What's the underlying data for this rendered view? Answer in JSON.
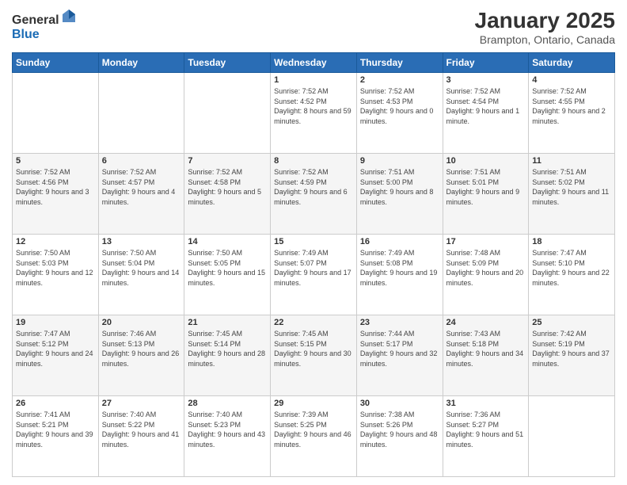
{
  "header": {
    "logo_general": "General",
    "logo_blue": "Blue",
    "month_year": "January 2025",
    "location": "Brampton, Ontario, Canada"
  },
  "days_of_week": [
    "Sunday",
    "Monday",
    "Tuesday",
    "Wednesday",
    "Thursday",
    "Friday",
    "Saturday"
  ],
  "weeks": [
    [
      {
        "day": "",
        "sunrise": "",
        "sunset": "",
        "daylight": ""
      },
      {
        "day": "",
        "sunrise": "",
        "sunset": "",
        "daylight": ""
      },
      {
        "day": "",
        "sunrise": "",
        "sunset": "",
        "daylight": ""
      },
      {
        "day": "1",
        "sunrise": "Sunrise: 7:52 AM",
        "sunset": "Sunset: 4:52 PM",
        "daylight": "Daylight: 8 hours and 59 minutes."
      },
      {
        "day": "2",
        "sunrise": "Sunrise: 7:52 AM",
        "sunset": "Sunset: 4:53 PM",
        "daylight": "Daylight: 9 hours and 0 minutes."
      },
      {
        "day": "3",
        "sunrise": "Sunrise: 7:52 AM",
        "sunset": "Sunset: 4:54 PM",
        "daylight": "Daylight: 9 hours and 1 minute."
      },
      {
        "day": "4",
        "sunrise": "Sunrise: 7:52 AM",
        "sunset": "Sunset: 4:55 PM",
        "daylight": "Daylight: 9 hours and 2 minutes."
      }
    ],
    [
      {
        "day": "5",
        "sunrise": "Sunrise: 7:52 AM",
        "sunset": "Sunset: 4:56 PM",
        "daylight": "Daylight: 9 hours and 3 minutes."
      },
      {
        "day": "6",
        "sunrise": "Sunrise: 7:52 AM",
        "sunset": "Sunset: 4:57 PM",
        "daylight": "Daylight: 9 hours and 4 minutes."
      },
      {
        "day": "7",
        "sunrise": "Sunrise: 7:52 AM",
        "sunset": "Sunset: 4:58 PM",
        "daylight": "Daylight: 9 hours and 5 minutes."
      },
      {
        "day": "8",
        "sunrise": "Sunrise: 7:52 AM",
        "sunset": "Sunset: 4:59 PM",
        "daylight": "Daylight: 9 hours and 6 minutes."
      },
      {
        "day": "9",
        "sunrise": "Sunrise: 7:51 AM",
        "sunset": "Sunset: 5:00 PM",
        "daylight": "Daylight: 9 hours and 8 minutes."
      },
      {
        "day": "10",
        "sunrise": "Sunrise: 7:51 AM",
        "sunset": "Sunset: 5:01 PM",
        "daylight": "Daylight: 9 hours and 9 minutes."
      },
      {
        "day": "11",
        "sunrise": "Sunrise: 7:51 AM",
        "sunset": "Sunset: 5:02 PM",
        "daylight": "Daylight: 9 hours and 11 minutes."
      }
    ],
    [
      {
        "day": "12",
        "sunrise": "Sunrise: 7:50 AM",
        "sunset": "Sunset: 5:03 PM",
        "daylight": "Daylight: 9 hours and 12 minutes."
      },
      {
        "day": "13",
        "sunrise": "Sunrise: 7:50 AM",
        "sunset": "Sunset: 5:04 PM",
        "daylight": "Daylight: 9 hours and 14 minutes."
      },
      {
        "day": "14",
        "sunrise": "Sunrise: 7:50 AM",
        "sunset": "Sunset: 5:05 PM",
        "daylight": "Daylight: 9 hours and 15 minutes."
      },
      {
        "day": "15",
        "sunrise": "Sunrise: 7:49 AM",
        "sunset": "Sunset: 5:07 PM",
        "daylight": "Daylight: 9 hours and 17 minutes."
      },
      {
        "day": "16",
        "sunrise": "Sunrise: 7:49 AM",
        "sunset": "Sunset: 5:08 PM",
        "daylight": "Daylight: 9 hours and 19 minutes."
      },
      {
        "day": "17",
        "sunrise": "Sunrise: 7:48 AM",
        "sunset": "Sunset: 5:09 PM",
        "daylight": "Daylight: 9 hours and 20 minutes."
      },
      {
        "day": "18",
        "sunrise": "Sunrise: 7:47 AM",
        "sunset": "Sunset: 5:10 PM",
        "daylight": "Daylight: 9 hours and 22 minutes."
      }
    ],
    [
      {
        "day": "19",
        "sunrise": "Sunrise: 7:47 AM",
        "sunset": "Sunset: 5:12 PM",
        "daylight": "Daylight: 9 hours and 24 minutes."
      },
      {
        "day": "20",
        "sunrise": "Sunrise: 7:46 AM",
        "sunset": "Sunset: 5:13 PM",
        "daylight": "Daylight: 9 hours and 26 minutes."
      },
      {
        "day": "21",
        "sunrise": "Sunrise: 7:45 AM",
        "sunset": "Sunset: 5:14 PM",
        "daylight": "Daylight: 9 hours and 28 minutes."
      },
      {
        "day": "22",
        "sunrise": "Sunrise: 7:45 AM",
        "sunset": "Sunset: 5:15 PM",
        "daylight": "Daylight: 9 hours and 30 minutes."
      },
      {
        "day": "23",
        "sunrise": "Sunrise: 7:44 AM",
        "sunset": "Sunset: 5:17 PM",
        "daylight": "Daylight: 9 hours and 32 minutes."
      },
      {
        "day": "24",
        "sunrise": "Sunrise: 7:43 AM",
        "sunset": "Sunset: 5:18 PM",
        "daylight": "Daylight: 9 hours and 34 minutes."
      },
      {
        "day": "25",
        "sunrise": "Sunrise: 7:42 AM",
        "sunset": "Sunset: 5:19 PM",
        "daylight": "Daylight: 9 hours and 37 minutes."
      }
    ],
    [
      {
        "day": "26",
        "sunrise": "Sunrise: 7:41 AM",
        "sunset": "Sunset: 5:21 PM",
        "daylight": "Daylight: 9 hours and 39 minutes."
      },
      {
        "day": "27",
        "sunrise": "Sunrise: 7:40 AM",
        "sunset": "Sunset: 5:22 PM",
        "daylight": "Daylight: 9 hours and 41 minutes."
      },
      {
        "day": "28",
        "sunrise": "Sunrise: 7:40 AM",
        "sunset": "Sunset: 5:23 PM",
        "daylight": "Daylight: 9 hours and 43 minutes."
      },
      {
        "day": "29",
        "sunrise": "Sunrise: 7:39 AM",
        "sunset": "Sunset: 5:25 PM",
        "daylight": "Daylight: 9 hours and 46 minutes."
      },
      {
        "day": "30",
        "sunrise": "Sunrise: 7:38 AM",
        "sunset": "Sunset: 5:26 PM",
        "daylight": "Daylight: 9 hours and 48 minutes."
      },
      {
        "day": "31",
        "sunrise": "Sunrise: 7:36 AM",
        "sunset": "Sunset: 5:27 PM",
        "daylight": "Daylight: 9 hours and 51 minutes."
      },
      {
        "day": "",
        "sunrise": "",
        "sunset": "",
        "daylight": ""
      }
    ]
  ]
}
